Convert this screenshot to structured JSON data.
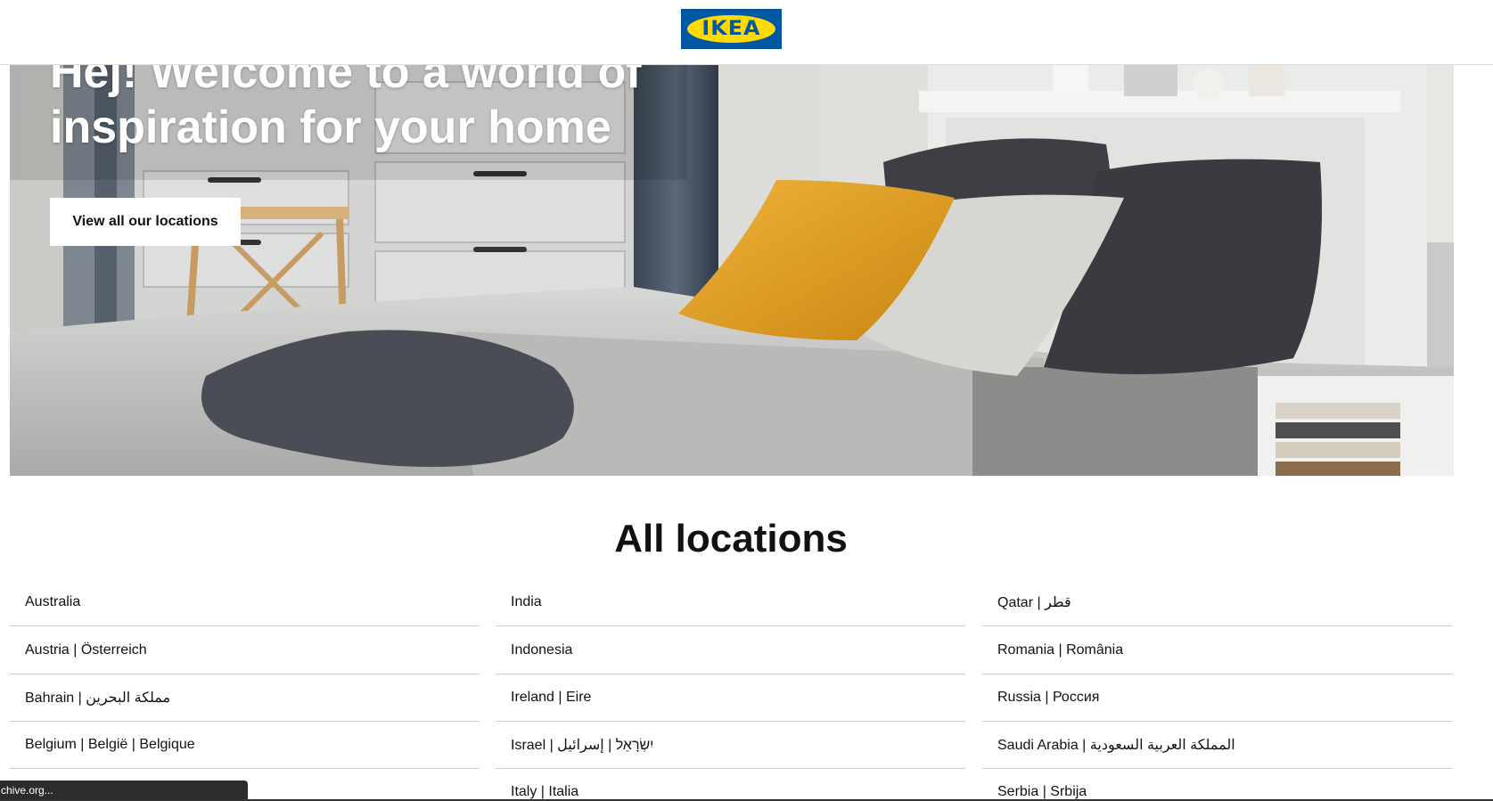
{
  "header": {
    "logo_text": "IKEA"
  },
  "hero": {
    "title": "Hej! Welcome to a world of inspiration for your home",
    "button_label": "View all our locations"
  },
  "locations": {
    "title": "All locations",
    "columns": [
      [
        "Australia",
        "Austria | Österreich",
        "Bahrain | مملكة البحرين",
        "Belgium | België | Belgique"
      ],
      [
        "India",
        "Indonesia",
        "Ireland | Eire",
        "Israel | יִשְׂרָאֵל | إسرائيل",
        "Italy | Italia"
      ],
      [
        "Qatar | قطر",
        "Romania | România",
        "Russia | Россия",
        "Saudi Arabia | المملكة العربية السعودية",
        "Serbia | Srbija"
      ]
    ]
  },
  "status_bar": {
    "text": "chive.org..."
  },
  "colors": {
    "brand_blue": "#0058a3",
    "brand_yellow": "#ffdb00"
  }
}
